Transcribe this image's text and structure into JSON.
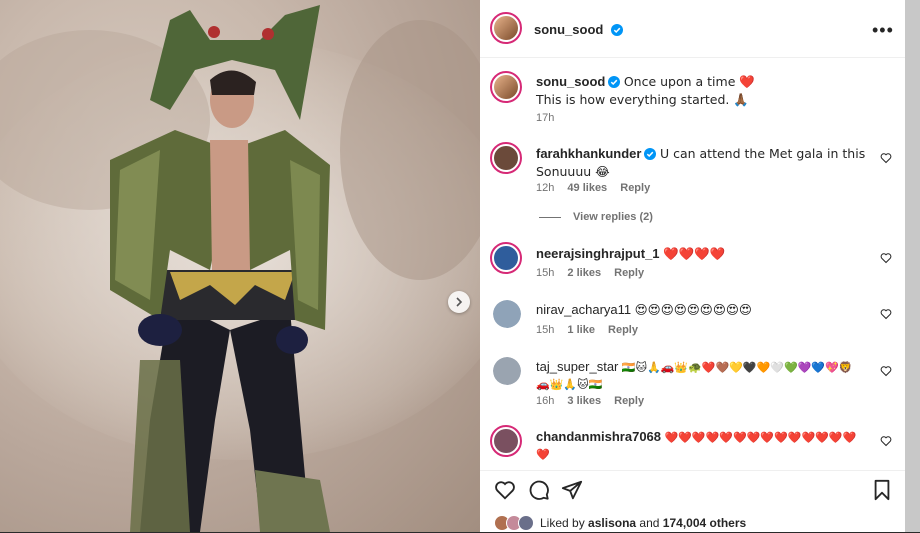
{
  "post_author": {
    "username": "sonu_sood",
    "verified": true
  },
  "caption": {
    "username": "sonu_sood",
    "line1": "Once upon a time ❤️",
    "line2": "This is how everything started. 🙏🏾",
    "time": "17h"
  },
  "comments": [
    {
      "username": "farahkhankunder",
      "verified": true,
      "text": "U can attend the Met gala in this Sonuuuu 😂",
      "time": "12h",
      "likes": "49 likes",
      "reply": "Reply",
      "avatar_color": "#6b4a3a"
    },
    {
      "username": "neerajsinghrajput_1",
      "verified": false,
      "text": "❤️❤️❤️❤️",
      "time": "15h",
      "likes": "2 likes",
      "reply": "Reply",
      "avatar_color": "#2f5d9c"
    },
    {
      "username": "nirav_acharya11",
      "verified": false,
      "text": "😍😍😍😍😍😍😍😍😍",
      "time": "15h",
      "likes": "1 like",
      "reply": "Reply",
      "avatar_color": "#8fa3b8"
    },
    {
      "username": "taj_super_star",
      "verified": false,
      "text": "🇮🇳🐱🙏🚗👑🐢❤️🤎💛🖤🧡🤍💚💜💙💖🦁🚗👑🙏🐱🇮🇳",
      "time": "16h",
      "likes": "3 likes",
      "reply": "Reply",
      "avatar_color": "#9aa4b0"
    },
    {
      "username": "chandanmishra7068",
      "verified": false,
      "text": "❤️❤️❤️❤️❤️❤️❤️❤️❤️❤️❤️❤️❤️❤️❤️",
      "time": "",
      "likes": "",
      "reply": "",
      "avatar_color": "#7a5060"
    }
  ],
  "view_replies": "View replies (2)",
  "liked_by": {
    "prefix": "Liked by ",
    "user": "aslisona",
    "mid": " and ",
    "count": "174,004 others"
  },
  "colors": {
    "accent_ring": "#d62976",
    "verified": "#0095f6",
    "heart": "#ed4956"
  }
}
